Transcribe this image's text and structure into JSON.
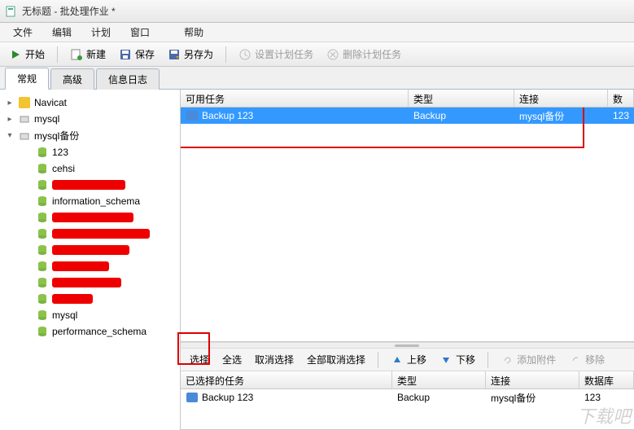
{
  "titlebar": {
    "title": "无标题 - 批处理作业 *"
  },
  "menubar": {
    "file": "文件",
    "edit": "编辑",
    "plan": "计划",
    "window": "窗口",
    "help": "帮助"
  },
  "toolbar": {
    "start": "开始",
    "new": "新建",
    "save": "保存",
    "save_as": "另存为",
    "set_plan": "设置计划任务",
    "delete_plan": "删除计划任务"
  },
  "tabs": {
    "general": "常规",
    "advanced": "高级",
    "log": "信息日志"
  },
  "sidebar": {
    "root": "Navicat",
    "conn_mysql": "mysql",
    "conn_backup": "mysql备份",
    "dbs": {
      "d0": "123",
      "d1": "cehsi",
      "d3": "information_schema",
      "d10": "mysql",
      "d11": "performance_schema"
    }
  },
  "available": {
    "header": {
      "task": "可用任务",
      "type": "类型",
      "conn": "连接",
      "db": "数据库"
    },
    "row0": {
      "task": "Backup 123",
      "type": "Backup",
      "conn": "mysql备份",
      "db": "123"
    }
  },
  "select_toolbar": {
    "select": "选择",
    "select_all": "全选",
    "deselect": "取消选择",
    "deselect_all": "全部取消选择",
    "move_up": "上移",
    "move_down": "下移",
    "add_attach": "添加附件",
    "remove": "移除"
  },
  "selected": {
    "header": {
      "task": "已选择的任务",
      "type": "类型",
      "conn": "连接",
      "db": "数据库"
    },
    "row0": {
      "task": "Backup 123",
      "type": "Backup",
      "conn": "mysql备份",
      "db": "123"
    }
  },
  "watermark": "下载吧"
}
